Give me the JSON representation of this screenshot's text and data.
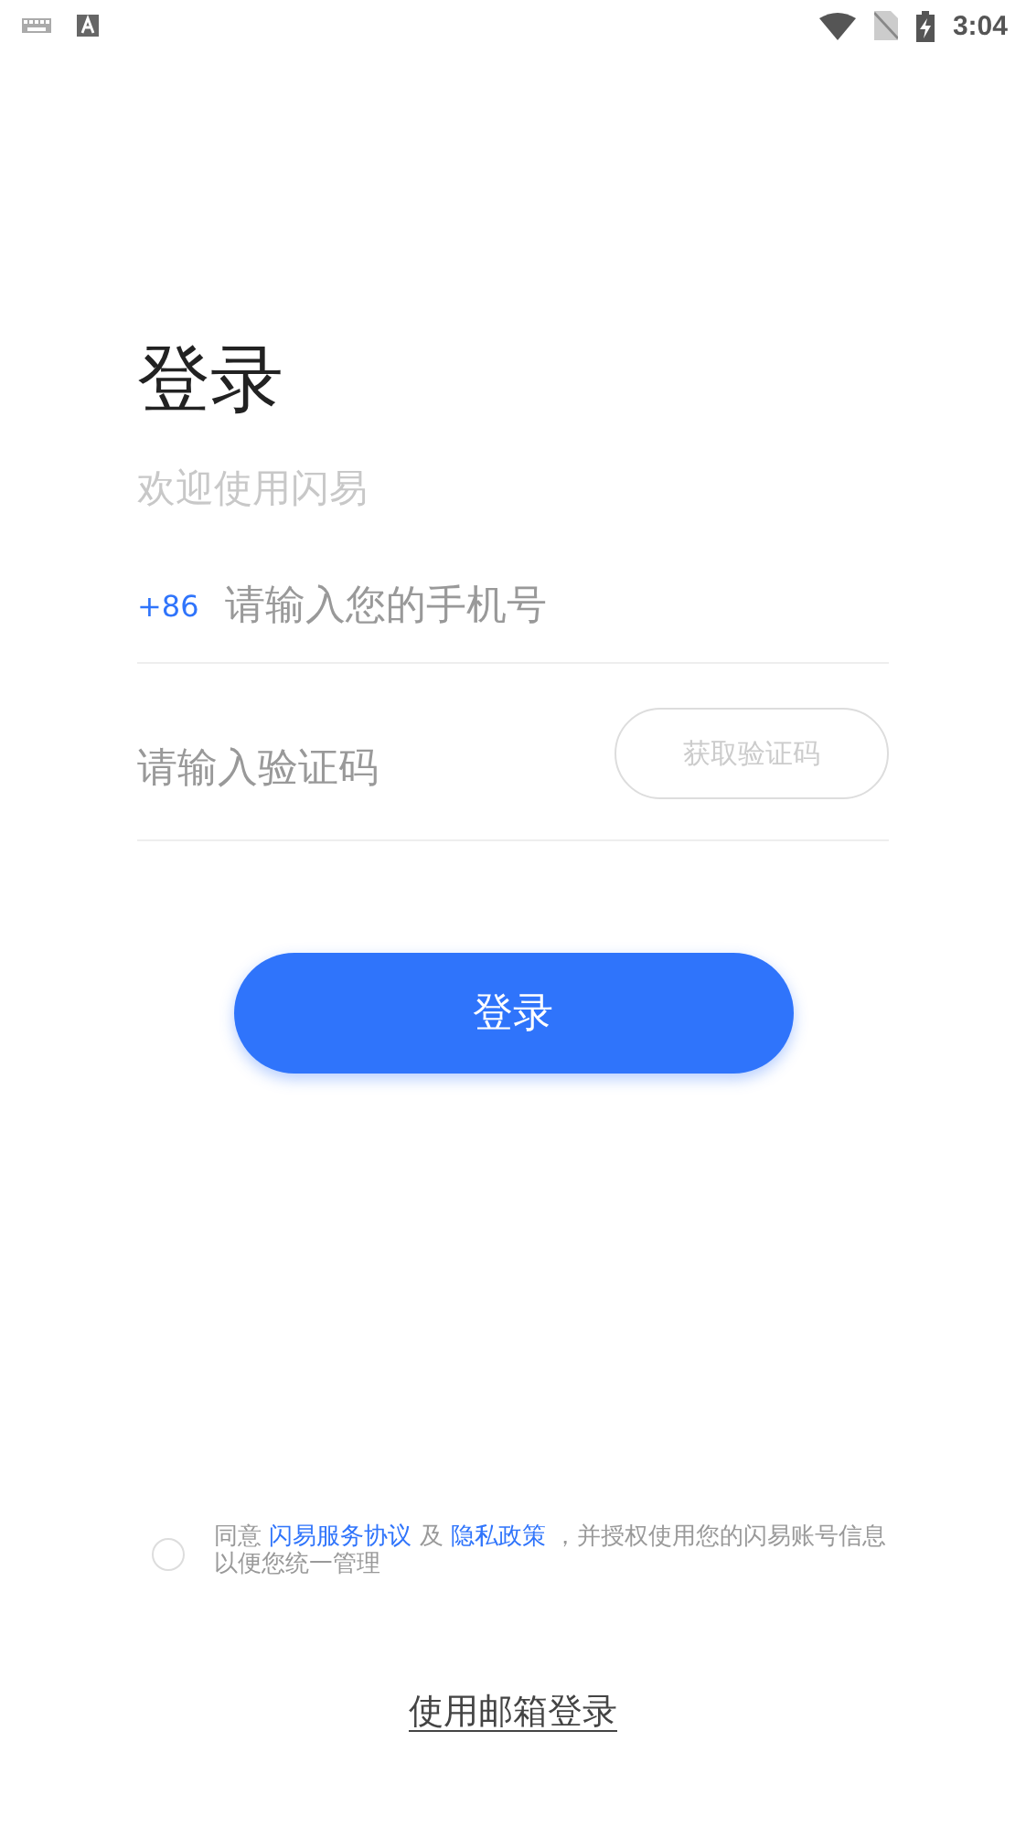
{
  "status_bar": {
    "time": "3:04"
  },
  "title": "登录",
  "subtitle": "欢迎使用闪易",
  "phone": {
    "prefix": "+86",
    "placeholder": "请输入您的手机号"
  },
  "code": {
    "placeholder": "请输入验证码",
    "button": "获取验证码",
    "button_disabled": true
  },
  "login_button": "登录",
  "agreement": {
    "checked": false,
    "parts": [
      {
        "kind": "text",
        "text": "同意 "
      },
      {
        "kind": "link",
        "text": "闪易服务协议"
      },
      {
        "kind": "text",
        "text": " 及 "
      },
      {
        "kind": "link",
        "text": "隐私政策"
      },
      {
        "kind": "text",
        "text": " ，并授权使用您的闪易账号信息以便您统一管理"
      }
    ]
  },
  "email_login": "使用邮箱登录"
}
